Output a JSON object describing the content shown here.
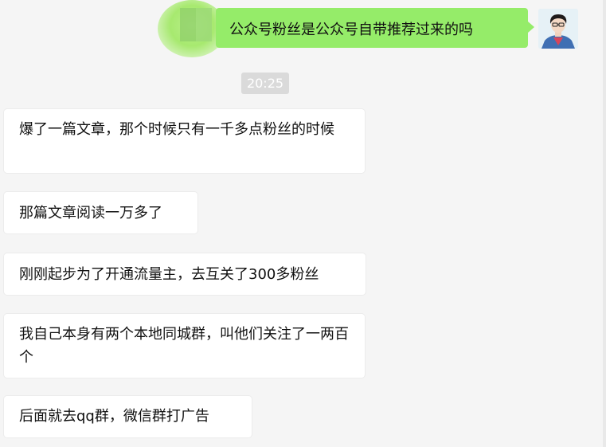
{
  "outgoing": {
    "text": "公众号粉丝是公众号自带推荐过来的吗"
  },
  "timestamp": "20:25",
  "incoming": [
    {
      "text": "爆了一篇文章，那个时候只有一千多点粉丝的时候"
    },
    {
      "text": "那篇文章阅读一万多了"
    },
    {
      "text": "刚刚起步为了开通流量主，去互关了300多粉丝"
    },
    {
      "text": "我自己本身有两个本地同城群，叫他们关注了一两百个"
    },
    {
      "text": "后面就去qq群，微信群打广告"
    }
  ],
  "colors": {
    "background": "#f5f5f5",
    "outgoing_bubble": "#95ec69",
    "incoming_bubble": "#ffffff",
    "timestamp_bg": "#dadada"
  },
  "icons": [
    "avatar",
    "blurred-redaction"
  ]
}
